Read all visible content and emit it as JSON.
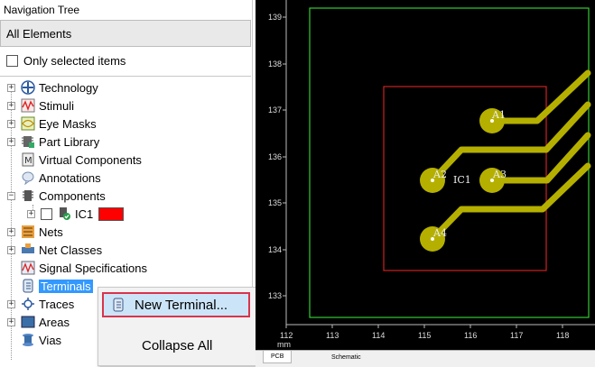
{
  "nav": {
    "title": "Navigation Tree",
    "filter_value": "All Elements",
    "only_selected_label": "Only selected items",
    "items": [
      {
        "label": "Technology"
      },
      {
        "label": "Stimuli"
      },
      {
        "label": "Eye Masks"
      },
      {
        "label": "Part Library"
      },
      {
        "label": "Virtual Components"
      },
      {
        "label": "Annotations"
      },
      {
        "label": "Components"
      },
      {
        "label": "IC1"
      },
      {
        "label": "Nets"
      },
      {
        "label": "Net Classes"
      },
      {
        "label": "Signal Specifications"
      },
      {
        "label": "Terminals"
      },
      {
        "label": "Traces"
      },
      {
        "label": "Areas"
      },
      {
        "label": "Vias"
      }
    ],
    "ic1_swatch_color": "#ff0000"
  },
  "context_menu": {
    "new_terminal": "New Terminal...",
    "collapse_all": "Collapse All"
  },
  "pcb": {
    "x_ticks": [
      "112",
      "113",
      "114",
      "115",
      "116",
      "117",
      "118"
    ],
    "y_ticks": [
      "139",
      "138",
      "137",
      "136",
      "135",
      "134",
      "133"
    ],
    "unit": "mm",
    "component_label": "IC1",
    "pads": [
      "A1",
      "A2",
      "A3",
      "A4"
    ],
    "board_outline_color": "#33cc33",
    "component_outline_color": "#cc2222",
    "trace_color": "#b5b000"
  },
  "tabs": [
    "PCB",
    "Schematic"
  ]
}
